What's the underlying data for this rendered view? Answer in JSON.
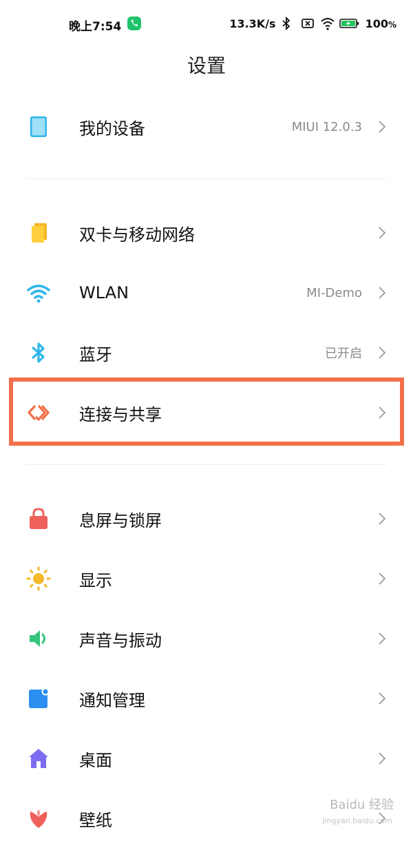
{
  "status_bar": {
    "time": "晚上7:54",
    "speed": "13.3K/s",
    "battery": "100",
    "battery_unit": "%"
  },
  "page": {
    "title": "设置"
  },
  "rows": {
    "my_device": {
      "label": "我的设备",
      "value": "MIUI 12.0.3"
    },
    "sim": {
      "label": "双卡与移动网络"
    },
    "wlan": {
      "label": "WLAN",
      "value": "MI-Demo"
    },
    "bluetooth": {
      "label": "蓝牙",
      "value": "已开启"
    },
    "connect": {
      "label": "连接与共享"
    },
    "lock": {
      "label": "息屏与锁屏"
    },
    "display": {
      "label": "显示"
    },
    "sound": {
      "label": "声音与振动"
    },
    "notify": {
      "label": "通知管理"
    },
    "desktop": {
      "label": "桌面"
    },
    "wallpaper": {
      "label": "壁纸"
    }
  },
  "watermark": {
    "text": "Baidu 经验",
    "url": "jingyan.baidu.com"
  },
  "colors": {
    "highlight": "#f1704a",
    "accent_blue": "#2fb6ea"
  }
}
